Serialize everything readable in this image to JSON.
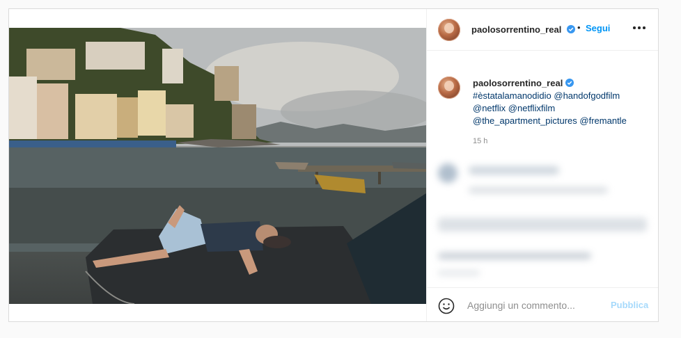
{
  "post": {
    "image_alt": "",
    "author": {
      "username": "paolosorrentino_real",
      "verified": true
    },
    "follow_label": "Segui",
    "separator": "•",
    "caption": {
      "username": "paolosorrentino_real",
      "hashtag": "#èstatalamanodidio",
      "mention_1": "@handofgodfilm",
      "mention_2": "@netflix",
      "mention_3": "@netflixfilm",
      "mention_4": "@the_apartment_pictures",
      "mention_5": "@fremantle"
    },
    "timestamp": "15 h",
    "comment_box": {
      "placeholder": "Aggiungi un commento...",
      "publish_label": "Pubblica"
    },
    "colors": {
      "accent": "#0095f6",
      "link": "#00376b",
      "muted": "#8e8e8e",
      "border": "#dbdbdb"
    },
    "icons": {
      "verified": "verified-badge-icon",
      "more": "more-options-icon",
      "emoji": "emoji-icon"
    }
  }
}
